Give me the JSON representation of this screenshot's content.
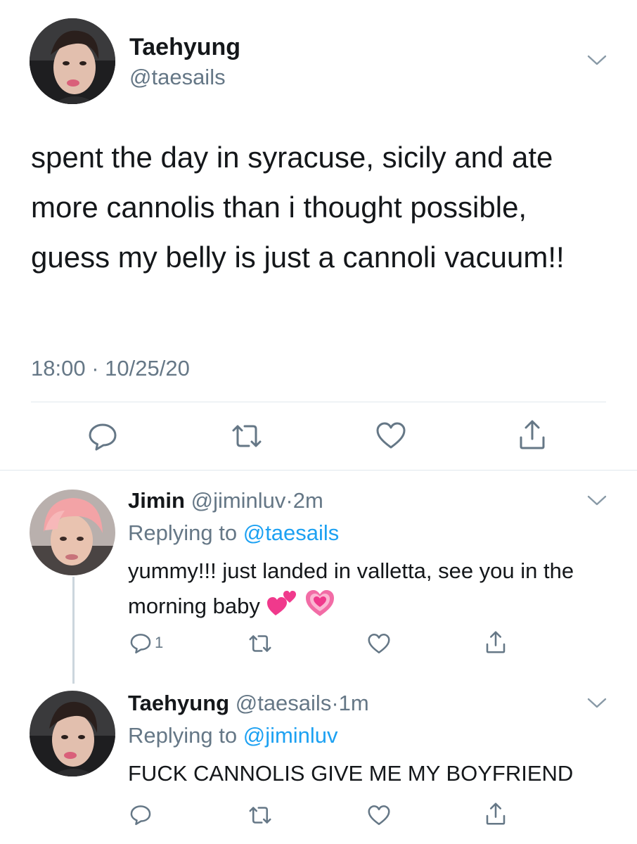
{
  "main_tweet": {
    "author_name": "Taehyung",
    "author_handle": "@taesails",
    "text": "spent the day in syracuse, sicily and ate more cannolis than i thought possible, guess my belly is just a cannoli vacuum!!",
    "time": "18:00",
    "separator": "·",
    "date": "10/25/20",
    "actions": [
      "reply-icon",
      "retweet-icon",
      "like-icon",
      "share-icon"
    ]
  },
  "replies": [
    {
      "author_name": "Jimin",
      "author_handle": "@jiminluv",
      "separator": "·",
      "age": "2m",
      "replying_prefix": "Replying to",
      "replying_to": "@taesails",
      "text": "yummy!!! just landed in valletta, see you in the morning baby",
      "emojis": [
        "two-hearts-emoji",
        "growing-heart-emoji"
      ],
      "reply_count": "1"
    },
    {
      "author_name": "Taehyung",
      "author_handle": "@taesails",
      "separator": "·",
      "age": "1m",
      "replying_prefix": "Replying to",
      "replying_to": "@jiminluv",
      "text": "FUCK CANNOLIS GIVE ME MY BOYFRIEND",
      "reply_count": ""
    }
  ],
  "colors": {
    "text": "#14171a",
    "secondary": "#657786",
    "link": "#1da1f2",
    "divider": "#e1e8ed",
    "thread_line": "#ccd6dd",
    "icon": "#657786"
  }
}
